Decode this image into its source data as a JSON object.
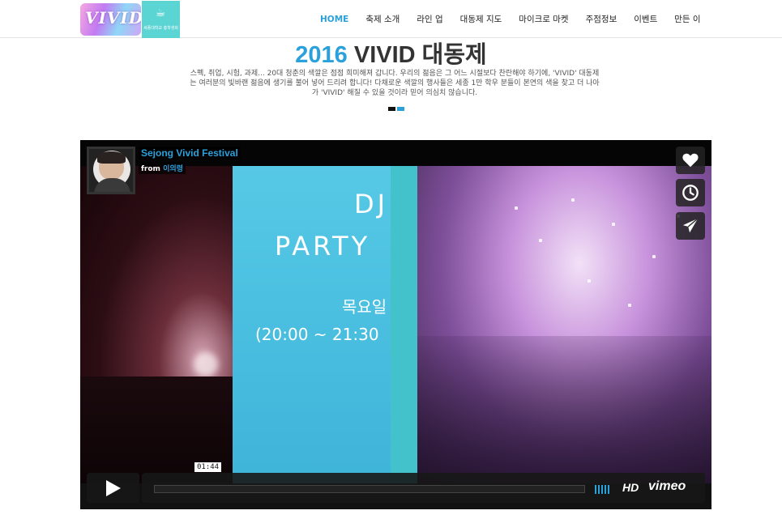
{
  "header": {
    "logo_text": "VIVID",
    "council_logo_text": "세종대학교 총학생회",
    "nav": [
      {
        "label": "HOME",
        "active": true
      },
      {
        "label": "축제 소개",
        "active": false
      },
      {
        "label": "라인 업",
        "active": false
      },
      {
        "label": "대동제 지도",
        "active": false
      },
      {
        "label": "마이크로 마켓",
        "active": false
      },
      {
        "label": "주점정보",
        "active": false
      },
      {
        "label": "이벤트",
        "active": false
      },
      {
        "label": "만든 이",
        "active": false
      }
    ]
  },
  "hero": {
    "year": "2016",
    "title_rest": "VIVID 대동제",
    "description": "스펙, 취업, 시험, 과제... 20대 청춘의 색깔은 점점 희미해져 갑니다. 우리의 젊음은 그 어느 시절보다 찬란해야 하기에, 'VIVID' 대동제는 여러분의 빛바랜 젊음에 생기를 불어 넣어 드리려 합니다! 다채로운 색깔의 행사들은 세종 1만 학우 분들이 본연의 색을 찾고 더 나아가 'VIVID' 해질 수 있을 것이라 믿어 의심치 않습니다.",
    "slide_count": 2,
    "active_slide": 2
  },
  "video": {
    "title": "Sejong Vivid Festival",
    "from_label": "from",
    "author": "이의령",
    "frame_text": {
      "line1": "DJ",
      "line2": "PARTY",
      "line3": "목요일",
      "line4": "(20:00 ~ 21:30"
    },
    "time": "01:44",
    "hd_label": "HD",
    "brand": "vimeo",
    "side_buttons": [
      "heart-icon",
      "clock-icon",
      "send-icon"
    ]
  },
  "colors": {
    "accent": "#2aa1db",
    "player_bg": "#111111",
    "text": "#333333"
  }
}
